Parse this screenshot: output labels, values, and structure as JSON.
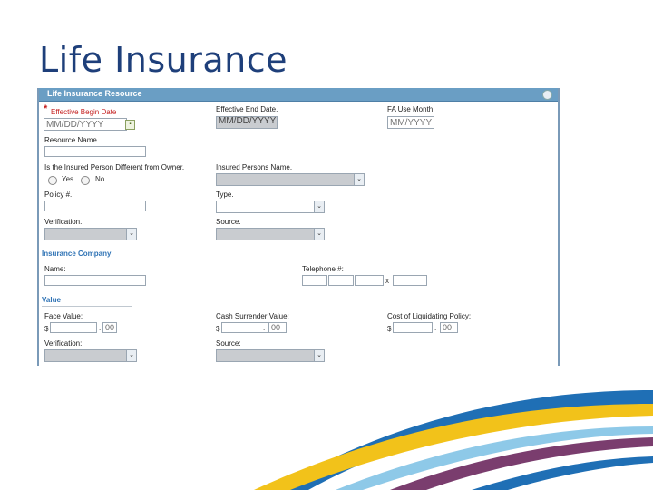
{
  "slide": {
    "title": "Life Insurance"
  },
  "panel": {
    "title": "Life Insurance Resource",
    "help_icon": "help-icon",
    "fields": {
      "effective_begin_date": {
        "label": "Effective Begin Date",
        "placeholder": "MM/DD/YYYY",
        "required_mark": "*"
      },
      "effective_end_date": {
        "label": "Effective End Date.",
        "value": "MM/DD/YYYY"
      },
      "fa_use_month": {
        "label": "FA Use Month.",
        "placeholder": "MM/YYYY"
      },
      "resource_name": {
        "label": "Resource Name."
      },
      "insured_different": {
        "label": "Is the Insured Person Different from Owner.",
        "options": [
          "Yes",
          "No"
        ]
      },
      "insured_persons_name": {
        "label": "Insured Persons Name."
      },
      "policy_number": {
        "label": "Policy #."
      },
      "type": {
        "label": "Type."
      },
      "verification_1": {
        "label": "Verification."
      },
      "source_1": {
        "label": "Source."
      },
      "name": {
        "label": "Name:"
      },
      "telephone": {
        "label": "Telephone #:",
        "ext_separator": "x"
      },
      "face_value": {
        "label": "Face Value:",
        "currency": "$",
        "decimal_sep": ".",
        "cents": "00"
      },
      "cash_surrender_value": {
        "label": "Cash Surrender Value:",
        "currency": "$",
        "decimal_sep": ".",
        "cents": "00"
      },
      "cost_of_liquidating": {
        "label": "Cost of Liquidating Policy:",
        "currency": "$",
        "decimal_sep": ".",
        "cents": "00"
      },
      "verification_2": {
        "label": "Verification:"
      },
      "source_2": {
        "label": "Source:"
      }
    },
    "sections": {
      "insurance_company": "Insurance Company",
      "value": "Value"
    }
  },
  "icons": {
    "calendar": "calendar-icon",
    "dropdown": "chevron-down-icon",
    "ribbon": "decorative-swoosh"
  },
  "colors": {
    "title": "#1e3f7a",
    "header": "#6a9ec4",
    "section": "#2f73b5",
    "required": "#c31e1e",
    "swoosh_yellow": "#f2c21a",
    "swoosh_blue": "#1f6fb5",
    "swoosh_lightblue": "#8ec9e8",
    "swoosh_purple": "#7a3d6e"
  }
}
